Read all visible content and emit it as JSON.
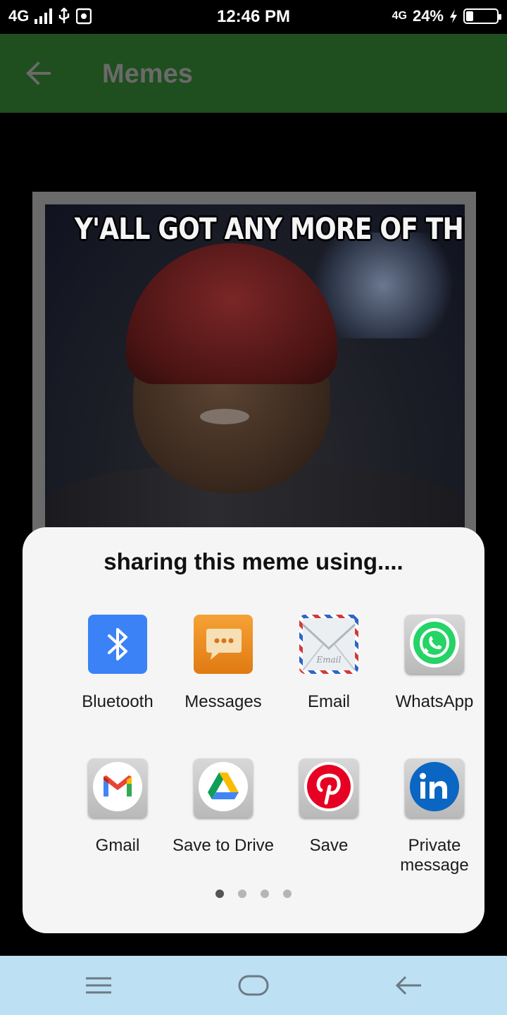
{
  "status_bar": {
    "network": "4G",
    "time": "12:46 PM",
    "network_right": "4G",
    "battery_percent": "24%",
    "battery_level": 0.24,
    "charging": true
  },
  "app_bar": {
    "title": "Memes",
    "back_icon": "arrow-left-icon",
    "color": "#1f4e1f"
  },
  "meme": {
    "caption": "Y'ALL GOT ANY MORE OF THE"
  },
  "share_sheet": {
    "title": "sharing this meme using....",
    "apps": [
      {
        "label": "Bluetooth",
        "icon": "bluetooth-icon"
      },
      {
        "label": "Messages",
        "icon": "messages-icon"
      },
      {
        "label": "Email",
        "icon": "email-icon"
      },
      {
        "label": "WhatsApp",
        "icon": "whatsapp-icon"
      },
      {
        "label": "Gmail",
        "icon": "gmail-icon"
      },
      {
        "label": "Save to Drive",
        "icon": "google-drive-icon"
      },
      {
        "label": "Save",
        "icon": "pinterest-icon"
      },
      {
        "label": "Private message",
        "icon": "linkedin-icon"
      }
    ],
    "page_count": 4,
    "current_page": 1
  },
  "nav_bar": {
    "buttons": [
      "menu-icon",
      "home-icon",
      "back-icon"
    ]
  }
}
